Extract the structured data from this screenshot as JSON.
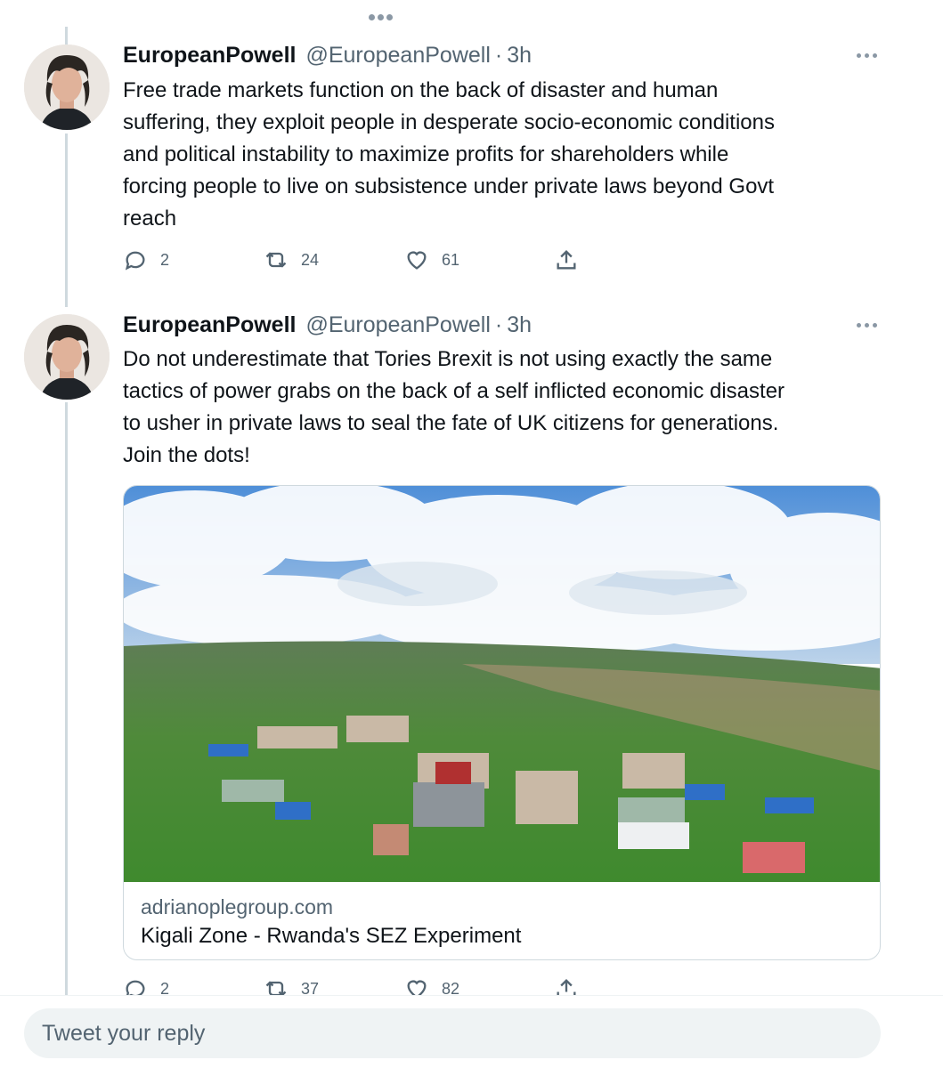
{
  "tweets": [
    {
      "display_name": "EuropeanPowell",
      "handle": "@EuropeanPowell",
      "separator": "·",
      "time": "3h",
      "text": "Free trade markets function on the back of disaster and human\nsuffering, they exploit people in desperate socio-economic conditions\nand political instability to maximize profits for shareholders while\nforcing people to live on subsistence under private laws beyond Govt\nreach",
      "replies": "2",
      "retweets": "24",
      "likes": "61"
    },
    {
      "display_name": "EuropeanPowell",
      "handle": "@EuropeanPowell",
      "separator": "·",
      "time": "3h",
      "text": "Do not underestimate that Tories Brexit is not using exactly the same\ntactics of power grabs on the back of a self inflicted economic disaster\nto usher in private laws to seal the fate of UK citizens for generations.\nJoin the dots!",
      "replies": "2",
      "retweets": "37",
      "likes": "82",
      "card": {
        "domain": "adrianoplegroup.com",
        "title": "Kigali Zone - Rwanda's SEZ Experiment"
      }
    }
  ],
  "reply": {
    "placeholder": "Tweet your reply"
  },
  "icons": {
    "reply": "speech-bubble-icon",
    "retweet": "retweet-icon",
    "like": "heart-icon",
    "share": "share-icon",
    "more": "more-dots-icon"
  },
  "colors": {
    "text": "#0f1419",
    "secondary": "#536471",
    "thread_line": "#cfd9de",
    "input_bg": "#eff3f4"
  }
}
